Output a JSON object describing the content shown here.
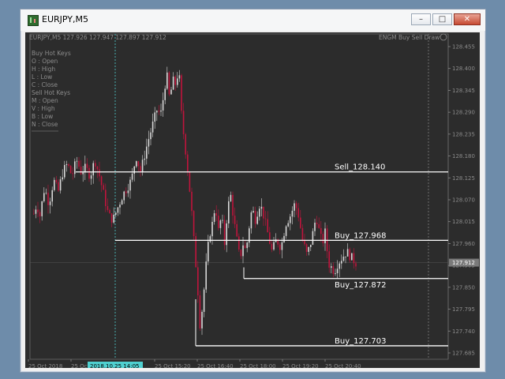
{
  "window": {
    "title": "EURJPY,M5",
    "controls": {
      "minimize": "–",
      "maximize": "□",
      "close": "✕"
    }
  },
  "chart_header": {
    "symbol_info": "EURJPY,M5  127.926 127.947 127.897 127.912",
    "indicator_name": "ENGM Buy Sell Draw"
  },
  "hotkeys": {
    "buy_title": "Buy Hot Keys",
    "buy_items": [
      "O : Open",
      "H : High",
      "L : Low",
      "C : Close"
    ],
    "sell_title": "Sell Hot Keys",
    "sell_items": [
      "M : Open",
      "V : High",
      "B : Low",
      "N : Close"
    ]
  },
  "chart_data": {
    "type": "candlestick",
    "symbol": "EURJPY",
    "timeframe": "M5",
    "price_axis_ticks": [
      "128.455",
      "128.400",
      "128.345",
      "128.290",
      "128.235",
      "128.180",
      "128.125",
      "128.070",
      "128.015",
      "127.960",
      "127.905",
      "127.850",
      "127.795",
      "127.740",
      "127.685"
    ],
    "ylim": [
      127.685,
      128.455
    ],
    "time_axis_ticks": [
      "25 Oct 2018",
      "25 Oct",
      "25 Oct 14:05",
      "25 Oct 15:20",
      "25 Oct 16:40",
      "25 Oct 18:00",
      "25 Oct 19:20",
      "25 Oct 20:40"
    ],
    "crosshair_time_label": "2018.10.25 14:05",
    "current_price": 127.912,
    "current_price_label": "127.912",
    "levels": [
      {
        "label": "Sell_128.140",
        "price": 128.14
      },
      {
        "label": "Buy_127.968",
        "price": 127.968
      },
      {
        "label": "Buy_127.872",
        "price": 127.872
      },
      {
        "label": "Buy_127.703",
        "price": 127.703
      }
    ],
    "colors": {
      "bull": "#d8d8d8",
      "bear": "#c0143c",
      "background": "#2c2c2c",
      "grid_text": "#8a8a8a",
      "crosshair": "#4fd0d0"
    }
  }
}
